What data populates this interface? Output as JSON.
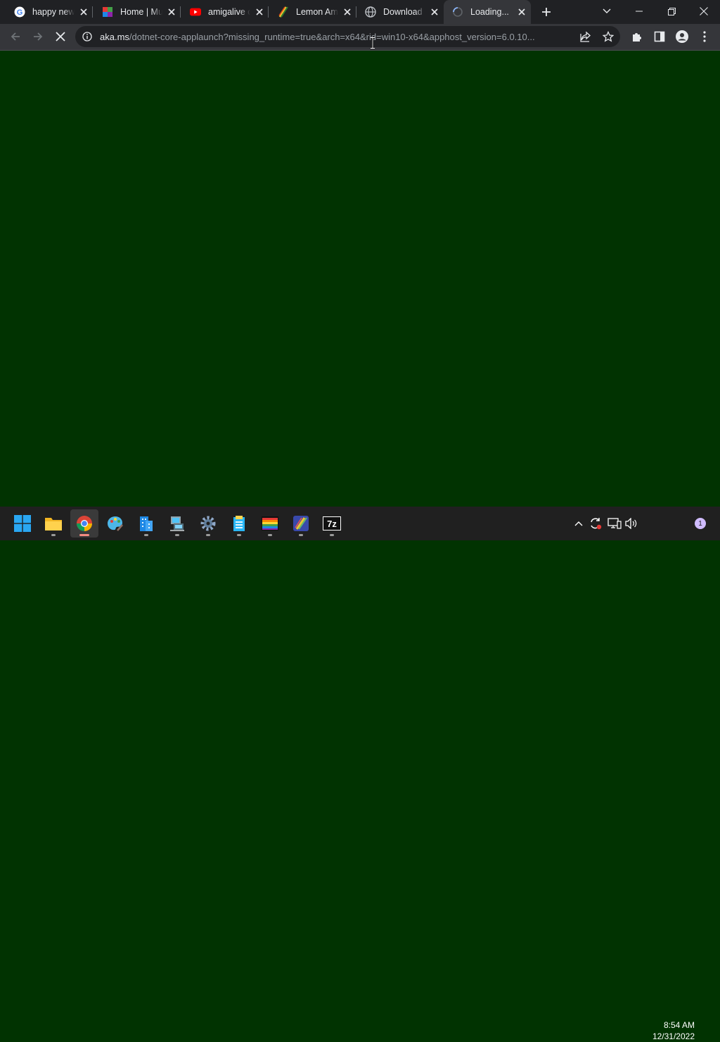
{
  "browser": {
    "tabs": [
      {
        "title": "happy new year",
        "icon": "google-icon",
        "active": false
      },
      {
        "title": "Home | Multi",
        "icon": "site-logo-icon",
        "active": false
      },
      {
        "title": "amigalive on",
        "icon": "youtube-icon",
        "active": false
      },
      {
        "title": "Lemon Amiga",
        "icon": "lemon-amiga-icon",
        "active": false
      },
      {
        "title": "Download .NET",
        "icon": "globe-icon",
        "active": false
      },
      {
        "title": "Loading...",
        "icon": "loading-spinner-icon",
        "active": true
      }
    ],
    "address_bar": {
      "host": "aka.ms",
      "path": "/dotnet-core-applaunch?missing_runtime=true&arch=x64&rid=win10-x64&apphost_version=6.0.10..."
    },
    "page_background": "#013301"
  },
  "taskbar": {
    "apps": [
      {
        "icon": "windows-start-icon"
      },
      {
        "icon": "file-explorer-icon"
      },
      {
        "icon": "chrome-icon",
        "active": true
      },
      {
        "icon": "paint-icon"
      },
      {
        "icon": "building-app-icon"
      },
      {
        "icon": "network-app-icon"
      },
      {
        "icon": "settings-gear-icon"
      },
      {
        "icon": "archive-app-icon"
      },
      {
        "icon": "amiga-emulator-icon"
      },
      {
        "icon": "lemon-amiga-app-icon"
      },
      {
        "icon": "7zip-icon"
      }
    ],
    "clock": {
      "time": "8:54 AM",
      "date": "12/31/2022"
    },
    "notification_count": "1"
  }
}
